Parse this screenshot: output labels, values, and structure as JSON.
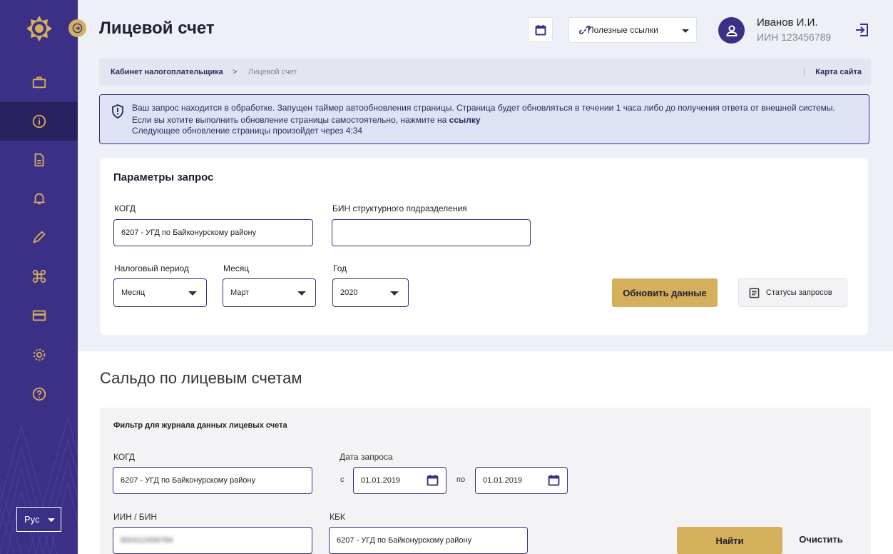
{
  "app": {
    "page_title": "Лицевой счет"
  },
  "header": {
    "links_label": "Полезные ссылки",
    "user_name": "Иванов И.И.",
    "user_iin": "ИИН 123456789"
  },
  "breadcrumb": {
    "items": [
      "Кабинет налогоплательщика",
      "Лицевой счет"
    ],
    "separator": ">",
    "sitemap": "Карта сайта"
  },
  "alert": {
    "line1": "Ваш запрос находится в обработке. Запущен таймер автообновления страницы. Страница будет обновляться в течении 1 часа либо до получения ответа от внешней системы.",
    "line2_prefix": "Если вы хотите выполнить обновление страницы самостоятельно, нажмите на ",
    "line2_link": "ссылку",
    "line3": "Следующее обновление страницы произойдет через 4:34"
  },
  "params": {
    "title": "Параметры запрос",
    "kogd_label": "КОГД",
    "kogd_value": "6207 - УГД по Байконурскому району",
    "bin_label": "БИН структурного подразделения",
    "bin_value": "",
    "period_label": "Налоговый период",
    "period_value": "Месяц",
    "month_label": "Месяц",
    "month_value": "Март",
    "year_label": "Год",
    "year_value": "2020",
    "refresh_button": "Обновить данные",
    "statuses_button": "Статусы запросов"
  },
  "balance": {
    "title": "Сальдо по лицевым счетам",
    "filter_title": "Фильтр для журнала данных лицевых счета",
    "kogd_label": "КОГД",
    "kogd_value": "6207 - УГД по Байконурскому району",
    "date_label": "Дата запроса",
    "from_label": "с",
    "date_from": "01.01.2019",
    "to_label": "по",
    "date_to": "01.01.2019",
    "iin_label": "ИИН / БИН",
    "iin_value": "800412456784",
    "kbk_label": "КБК",
    "kbk_value": "6207 - УГД по Байконурскому району",
    "find_button": "Найти",
    "clear_button": "Очистить"
  },
  "sidebar": {
    "language": "Рус",
    "icons": [
      "briefcase-icon",
      "info-icon",
      "document-icon",
      "bell-icon",
      "pencil-icon",
      "command-icon",
      "card-icon",
      "gear-icon",
      "help-icon"
    ]
  },
  "colors": {
    "sidebar": "#3b2f86",
    "accent_gold": "#d4b05c",
    "alert_bg": "#dfe1f4"
  }
}
